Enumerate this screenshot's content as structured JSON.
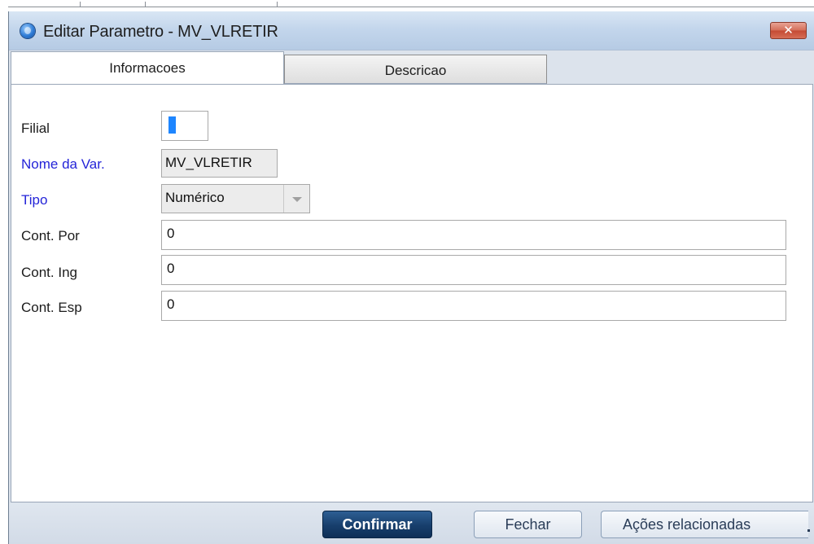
{
  "window": {
    "title": "Editar Parametro - MV_VLRETIR",
    "close_label": "✕"
  },
  "tabs": [
    {
      "label": "Informacoes",
      "active": true
    },
    {
      "label": "Descricao",
      "active": false
    }
  ],
  "form": {
    "filial": {
      "label": "Filial",
      "value": ""
    },
    "nome_var": {
      "label": "Nome da Var.",
      "value": "MV_VLRETIR"
    },
    "tipo": {
      "label": "Tipo",
      "value": "Numérico"
    },
    "cont_por": {
      "label": "Cont. Por",
      "value": "0"
    },
    "cont_ing": {
      "label": "Cont. Ing",
      "value": "0"
    },
    "cont_esp": {
      "label": "Cont. Esp",
      "value": "0"
    }
  },
  "footer": {
    "confirm_label": "Confirmar",
    "close_label": "Fechar",
    "actions_label": "Ações relacionadas"
  },
  "colors": {
    "required_label": "#2424d8",
    "primary_button": "#173e6c",
    "title_bar": "#c3d6ec"
  }
}
